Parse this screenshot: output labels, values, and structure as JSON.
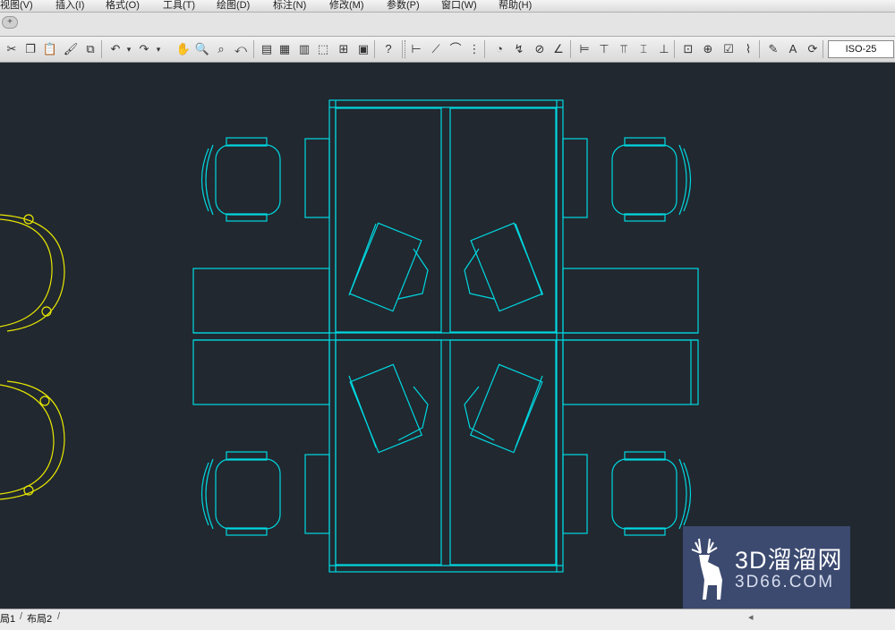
{
  "menu": {
    "items": [
      {
        "label": "视图(V)"
      },
      {
        "label": "插入(I)"
      },
      {
        "label": "格式(O)"
      },
      {
        "label": "工具(T)"
      },
      {
        "label": "绘图(D)"
      },
      {
        "label": "标注(N)"
      },
      {
        "label": "修改(M)"
      },
      {
        "label": "参数(P)"
      },
      {
        "label": "窗口(W)"
      },
      {
        "label": "帮助(H)"
      }
    ]
  },
  "tabstrip": {
    "new_tab_icon": "plus-icon"
  },
  "toolbar": {
    "tools": [
      {
        "name": "cut-icon",
        "glyph": "✂"
      },
      {
        "name": "copy-icon",
        "glyph": "❐"
      },
      {
        "name": "paste-icon",
        "glyph": "📋"
      },
      {
        "name": "match-properties-icon",
        "glyph": "🖌"
      },
      {
        "name": "block-editor-icon",
        "glyph": "⧉"
      },
      {
        "name": "undo-icon",
        "glyph": "↶"
      },
      {
        "name": "undo-dropdown-icon",
        "glyph": "▾"
      },
      {
        "name": "redo-icon",
        "glyph": "↷"
      },
      {
        "name": "redo-dropdown-icon",
        "glyph": "▾"
      },
      {
        "name": "pan-icon",
        "glyph": "✋"
      },
      {
        "name": "zoom-realtime-icon",
        "glyph": "🔍"
      },
      {
        "name": "zoom-window-icon",
        "glyph": "⌕"
      },
      {
        "name": "zoom-previous-icon",
        "glyph": "⤺"
      },
      {
        "name": "properties-icon",
        "glyph": "▤"
      },
      {
        "name": "design-center-icon",
        "glyph": "▦"
      },
      {
        "name": "tool-palettes-icon",
        "glyph": "▥"
      },
      {
        "name": "sheet-set-icon",
        "glyph": "⬚"
      },
      {
        "name": "markup-icon",
        "glyph": "⊞"
      },
      {
        "name": "calculator-icon",
        "glyph": "▣"
      },
      {
        "name": "help-icon",
        "glyph": "?"
      },
      {
        "name": "dim-linear-icon",
        "glyph": "⊢"
      },
      {
        "name": "dim-aligned-icon",
        "glyph": "⟋"
      },
      {
        "name": "dim-arc-icon",
        "glyph": "⌒"
      },
      {
        "name": "dim-ordinate-icon",
        "glyph": "⋮"
      },
      {
        "name": "dim-radius-icon",
        "glyph": "◔"
      },
      {
        "name": "dim-jogged-icon",
        "glyph": "↯"
      },
      {
        "name": "dim-diameter-icon",
        "glyph": "⊘"
      },
      {
        "name": "dim-angular-icon",
        "glyph": "∠"
      },
      {
        "name": "quick-dim-icon",
        "glyph": "⊨"
      },
      {
        "name": "dim-baseline-icon",
        "glyph": "⊤"
      },
      {
        "name": "dim-continue-icon",
        "glyph": "⫪"
      },
      {
        "name": "dim-space-icon",
        "glyph": "⌶"
      },
      {
        "name": "dim-break-icon",
        "glyph": "⊥"
      },
      {
        "name": "tolerance-icon",
        "glyph": "⊡"
      },
      {
        "name": "center-mark-icon",
        "glyph": "⊕"
      },
      {
        "name": "inspect-icon",
        "glyph": "☑"
      },
      {
        "name": "jogged-linear-icon",
        "glyph": "⌇"
      },
      {
        "name": "dim-edit-icon",
        "glyph": "✎"
      },
      {
        "name": "dim-text-edit-icon",
        "glyph": "A"
      },
      {
        "name": "dim-update-icon",
        "glyph": "⟳"
      }
    ],
    "dim_style": "ISO-25"
  },
  "status": {
    "layout_tabs": [
      {
        "label": "局1"
      },
      {
        "label": "布局2"
      }
    ]
  },
  "watermark": {
    "main": "3D溜溜网",
    "sub": "3D66.COM",
    "logo_icon": "deer-logo-icon"
  },
  "colors": {
    "canvas_bg": "#212830",
    "cyan": "#00d8e0",
    "yellow": "#e8e800",
    "watermark_bg": "#3c4a70"
  }
}
